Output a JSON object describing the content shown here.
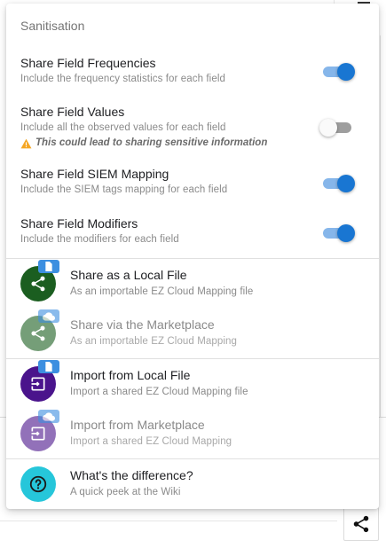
{
  "section_title": "Sanitisation",
  "options": [
    {
      "title": "Share Field Frequencies",
      "subtitle": "Include the frequency statistics for each field",
      "enabled": true
    },
    {
      "title": "Share Field Values",
      "subtitle": "Include all the observed values for each field",
      "enabled": false,
      "warning": "This could lead to sharing sensitive information",
      "warning_icon": "warning-triangle-icon"
    },
    {
      "title": "Share Field SIEM Mapping",
      "subtitle": "Include the SIEM tags mapping for each field",
      "enabled": true
    },
    {
      "title": "Share Field Modifiers",
      "subtitle": "Include the modifiers for each field",
      "enabled": true
    }
  ],
  "actions": [
    {
      "title": "Share as a Local File",
      "subtitle": "As an importable EZ Cloud Mapping file",
      "icon": "share-icon",
      "badge_icon": "file-icon",
      "avatar_color": "#1b5e20",
      "badge_color": "#3d8fe0",
      "disabled": false
    },
    {
      "title": "Share via the Marketplace",
      "subtitle": "As an importable EZ Cloud Mapping",
      "icon": "share-icon",
      "badge_icon": "cloud-icon",
      "avatar_color": "#1b5e20",
      "badge_color": "#3d8fe0",
      "disabled": true
    },
    {
      "title": "Import from Local File",
      "subtitle": "Import a shared EZ Cloud Mapping file",
      "icon": "import-icon",
      "badge_icon": "file-icon",
      "avatar_color": "#4a148c",
      "badge_color": "#3d8fe0",
      "disabled": false
    },
    {
      "title": "Import from Marketplace",
      "subtitle": "Import a shared EZ Cloud Mapping",
      "icon": "import-icon",
      "badge_icon": "cloud-icon",
      "avatar_color": "#4a148c",
      "badge_color": "#3d8fe0",
      "disabled": true
    },
    {
      "title": "What's the difference?",
      "subtitle": "A quick peek at the Wiki",
      "icon": "help-icon",
      "badge_icon": "",
      "avatar_color": "#26c6da",
      "badge_color": "",
      "disabled": false
    }
  ],
  "colors": {
    "accent": "#1976d2",
    "warning": "#f5a623"
  }
}
